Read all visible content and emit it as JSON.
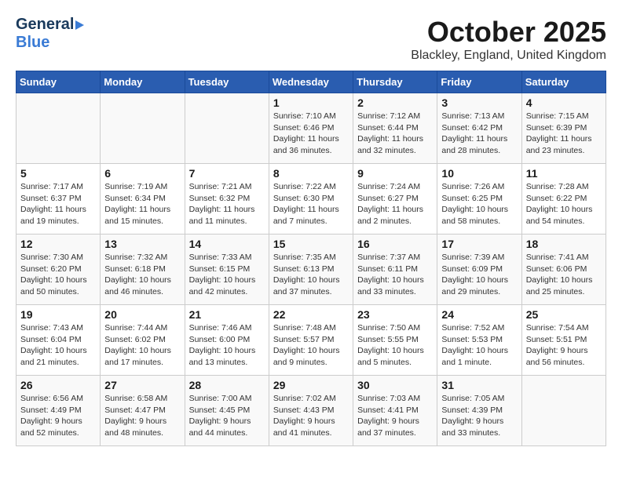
{
  "header": {
    "logo_general": "General",
    "logo_blue": "Blue",
    "month_title": "October 2025",
    "location": "Blackley, England, United Kingdom"
  },
  "weekdays": [
    "Sunday",
    "Monday",
    "Tuesday",
    "Wednesday",
    "Thursday",
    "Friday",
    "Saturday"
  ],
  "weeks": [
    [
      {
        "day": "",
        "info": ""
      },
      {
        "day": "",
        "info": ""
      },
      {
        "day": "",
        "info": ""
      },
      {
        "day": "1",
        "info": "Sunrise: 7:10 AM\nSunset: 6:46 PM\nDaylight: 11 hours\nand 36 minutes."
      },
      {
        "day": "2",
        "info": "Sunrise: 7:12 AM\nSunset: 6:44 PM\nDaylight: 11 hours\nand 32 minutes."
      },
      {
        "day": "3",
        "info": "Sunrise: 7:13 AM\nSunset: 6:42 PM\nDaylight: 11 hours\nand 28 minutes."
      },
      {
        "day": "4",
        "info": "Sunrise: 7:15 AM\nSunset: 6:39 PM\nDaylight: 11 hours\nand 23 minutes."
      }
    ],
    [
      {
        "day": "5",
        "info": "Sunrise: 7:17 AM\nSunset: 6:37 PM\nDaylight: 11 hours\nand 19 minutes."
      },
      {
        "day": "6",
        "info": "Sunrise: 7:19 AM\nSunset: 6:34 PM\nDaylight: 11 hours\nand 15 minutes."
      },
      {
        "day": "7",
        "info": "Sunrise: 7:21 AM\nSunset: 6:32 PM\nDaylight: 11 hours\nand 11 minutes."
      },
      {
        "day": "8",
        "info": "Sunrise: 7:22 AM\nSunset: 6:30 PM\nDaylight: 11 hours\nand 7 minutes."
      },
      {
        "day": "9",
        "info": "Sunrise: 7:24 AM\nSunset: 6:27 PM\nDaylight: 11 hours\nand 2 minutes."
      },
      {
        "day": "10",
        "info": "Sunrise: 7:26 AM\nSunset: 6:25 PM\nDaylight: 10 hours\nand 58 minutes."
      },
      {
        "day": "11",
        "info": "Sunrise: 7:28 AM\nSunset: 6:22 PM\nDaylight: 10 hours\nand 54 minutes."
      }
    ],
    [
      {
        "day": "12",
        "info": "Sunrise: 7:30 AM\nSunset: 6:20 PM\nDaylight: 10 hours\nand 50 minutes."
      },
      {
        "day": "13",
        "info": "Sunrise: 7:32 AM\nSunset: 6:18 PM\nDaylight: 10 hours\nand 46 minutes."
      },
      {
        "day": "14",
        "info": "Sunrise: 7:33 AM\nSunset: 6:15 PM\nDaylight: 10 hours\nand 42 minutes."
      },
      {
        "day": "15",
        "info": "Sunrise: 7:35 AM\nSunset: 6:13 PM\nDaylight: 10 hours\nand 37 minutes."
      },
      {
        "day": "16",
        "info": "Sunrise: 7:37 AM\nSunset: 6:11 PM\nDaylight: 10 hours\nand 33 minutes."
      },
      {
        "day": "17",
        "info": "Sunrise: 7:39 AM\nSunset: 6:09 PM\nDaylight: 10 hours\nand 29 minutes."
      },
      {
        "day": "18",
        "info": "Sunrise: 7:41 AM\nSunset: 6:06 PM\nDaylight: 10 hours\nand 25 minutes."
      }
    ],
    [
      {
        "day": "19",
        "info": "Sunrise: 7:43 AM\nSunset: 6:04 PM\nDaylight: 10 hours\nand 21 minutes."
      },
      {
        "day": "20",
        "info": "Sunrise: 7:44 AM\nSunset: 6:02 PM\nDaylight: 10 hours\nand 17 minutes."
      },
      {
        "day": "21",
        "info": "Sunrise: 7:46 AM\nSunset: 6:00 PM\nDaylight: 10 hours\nand 13 minutes."
      },
      {
        "day": "22",
        "info": "Sunrise: 7:48 AM\nSunset: 5:57 PM\nDaylight: 10 hours\nand 9 minutes."
      },
      {
        "day": "23",
        "info": "Sunrise: 7:50 AM\nSunset: 5:55 PM\nDaylight: 10 hours\nand 5 minutes."
      },
      {
        "day": "24",
        "info": "Sunrise: 7:52 AM\nSunset: 5:53 PM\nDaylight: 10 hours\nand 1 minute."
      },
      {
        "day": "25",
        "info": "Sunrise: 7:54 AM\nSunset: 5:51 PM\nDaylight: 9 hours\nand 56 minutes."
      }
    ],
    [
      {
        "day": "26",
        "info": "Sunrise: 6:56 AM\nSunset: 4:49 PM\nDaylight: 9 hours\nand 52 minutes."
      },
      {
        "day": "27",
        "info": "Sunrise: 6:58 AM\nSunset: 4:47 PM\nDaylight: 9 hours\nand 48 minutes."
      },
      {
        "day": "28",
        "info": "Sunrise: 7:00 AM\nSunset: 4:45 PM\nDaylight: 9 hours\nand 44 minutes."
      },
      {
        "day": "29",
        "info": "Sunrise: 7:02 AM\nSunset: 4:43 PM\nDaylight: 9 hours\nand 41 minutes."
      },
      {
        "day": "30",
        "info": "Sunrise: 7:03 AM\nSunset: 4:41 PM\nDaylight: 9 hours\nand 37 minutes."
      },
      {
        "day": "31",
        "info": "Sunrise: 7:05 AM\nSunset: 4:39 PM\nDaylight: 9 hours\nand 33 minutes."
      },
      {
        "day": "",
        "info": ""
      }
    ]
  ]
}
